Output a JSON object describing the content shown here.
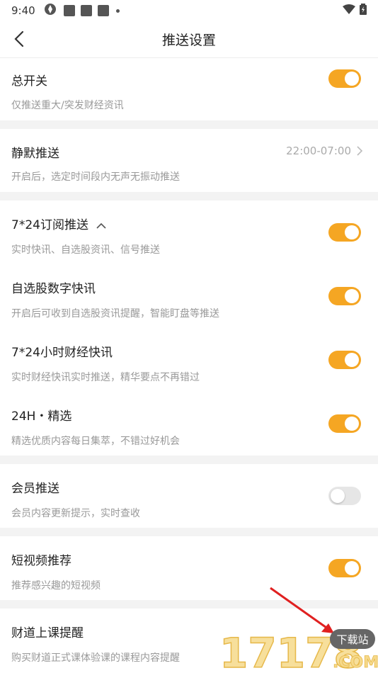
{
  "status_bar": {
    "time": "9:40"
  },
  "nav": {
    "title": "推送设置"
  },
  "sections": {
    "master": {
      "name": "总开关",
      "desc": "仅推送重大/突发财经资讯",
      "on": true
    },
    "quiet": {
      "name": "静默推送",
      "desc": "开启后，选定时间段内无声无振动推送",
      "value": "22:00-07:00"
    },
    "sub724": {
      "name": "7*24订阅推送",
      "desc": "实时快讯、自选股资讯、信号推送",
      "on": true
    },
    "stock_flash": {
      "name": "自选股数字快讯",
      "desc": "开启后可收到自选股资讯提醒，智能盯盘等推送",
      "on": true
    },
    "hour724": {
      "name": "7*24小时财经快讯",
      "desc": "实时财经快讯实时推送，精华要点不再错过",
      "on": true
    },
    "h24_pick": {
      "name": "24H・精选",
      "desc": "精选优质内容每日集萃，不错过好机会",
      "on": true
    },
    "member": {
      "name": "会员推送",
      "desc": "会员内容更新提示，实时查收",
      "on": false
    },
    "short_video": {
      "name": "短视频推荐",
      "desc": "推荐感兴趣的短视频",
      "on": true
    },
    "class_remind": {
      "name": "财道上课提醒",
      "desc": "购买财道正式课体验课的课程内容提醒"
    }
  },
  "watermark": {
    "site_text": "17178",
    "badge": "下载站",
    "domain": ".COM"
  },
  "colors": {
    "accent": "#f5a623",
    "toggle_off": "#e6e6e6",
    "separator": "#f3f3f3"
  }
}
